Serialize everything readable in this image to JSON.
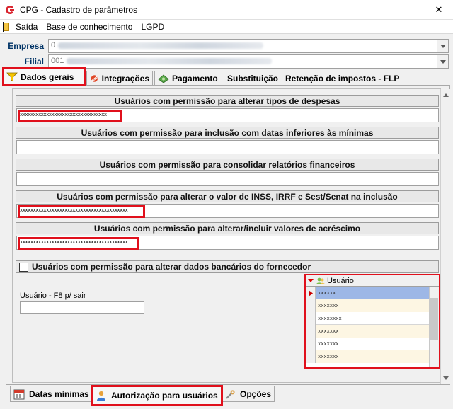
{
  "window": {
    "title": "CPG - Cadastro de parâmetros",
    "close_glyph": "✕"
  },
  "menu": {
    "items": [
      {
        "label": "Saída",
        "icon": "exit-door-icon"
      },
      {
        "label": "Base de conhecimento"
      },
      {
        "label": "LGPD"
      }
    ]
  },
  "fields": {
    "empresa": {
      "label": "Empresa",
      "value": "0"
    },
    "filial": {
      "label": "Filial",
      "value": "001"
    }
  },
  "top_tabs": [
    {
      "label": "Dados gerais",
      "icon": "funnel-icon",
      "active": true
    },
    {
      "label": "Integrações",
      "icon": "integration-icon"
    },
    {
      "label": "Pagamento",
      "icon": "money-icon"
    },
    {
      "label": "Substituição"
    },
    {
      "label": "Retenção de impostos - FLP"
    }
  ],
  "sections": [
    {
      "title": "Usuários com permissão para alterar tipos de despesas",
      "value": "xxxxxxxxxxxxxxxxxxxxxxxxxxxxxxxxx"
    },
    {
      "title": "Usuários com permissão para inclusão com datas inferiores às mínimas",
      "value": ""
    },
    {
      "title": "Usuários com permissão para consolidar relatórios financeiros",
      "value": ""
    },
    {
      "title": "Usuários com permissão para alterar o valor de INSS, IRRF e Sest/Senat na inclusão",
      "value": "xxxxxxxxxxxxxxxxxxxxxxxxxxxxxxxxxxxxxxxxx"
    },
    {
      "title": "Usuários com permissão para alterar/incluir valores de acréscimo",
      "value": "xxxxxxxxxxxxxxxxxxxxxxxxxxxxxxxxxxxxxxxxx"
    }
  ],
  "bank_check": {
    "label": "Usuários com permissão para alterar dados bancários do fornecedor",
    "checked": false
  },
  "user_field": {
    "label": "Usuário - F8 p/ sair",
    "value": ""
  },
  "grid": {
    "column": "Usuário",
    "rows": [
      "xxxxxx",
      "xxxxxxx",
      "xxxxxxxx",
      "xxxxxxx",
      "xxxxxxx",
      "xxxxxxx"
    ]
  },
  "bottom_tabs": [
    {
      "label": "Datas mínimas",
      "icon": "calendar-icon"
    },
    {
      "label": "Autorização para usuários",
      "icon": "user-icon",
      "active": true
    },
    {
      "label": "Opções",
      "icon": "wrench-icon"
    }
  ],
  "colors": {
    "highlight": "#e0101c",
    "selected_row": "#9db7e6",
    "label_text": "#003366"
  }
}
